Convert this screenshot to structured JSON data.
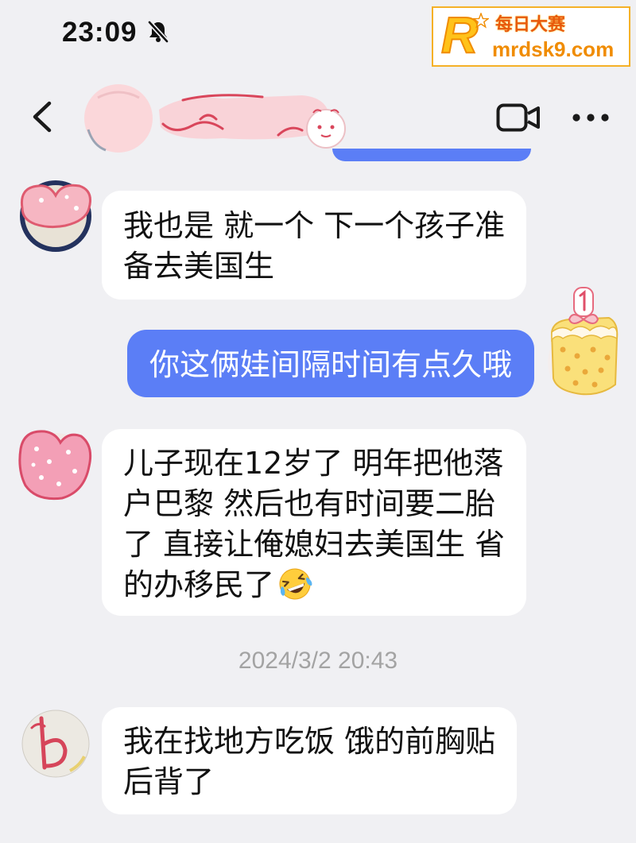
{
  "status_bar": {
    "time": "23:09",
    "mute_icon": "bell-slash-icon"
  },
  "watermark": {
    "logo_letter": "R",
    "brand_text": "每日大赛",
    "site_text": "mrdsk9.com"
  },
  "header": {
    "back_icon": "chevron-left-icon",
    "video_call_icon": "video-camera-icon",
    "more_icon": "more-dots-icon"
  },
  "chat": {
    "messages": [
      {
        "lines": [
          "我也是 就一个 下一个孩子准",
          "备去美国生"
        ]
      },
      {
        "lines": [
          "你这俩娃间隔时间有点久哦"
        ]
      },
      {
        "lines": [
          "儿子现在12岁了 明年把他落",
          "户巴黎 然后也有时间要二胎",
          "了 直接让俺媳妇去美国生 省",
          "的办移民了"
        ],
        "emoji": "rofl-emoji-icon"
      },
      {
        "lines": [
          "我在找地方吃饭 饿的前胸贴",
          "后背了"
        ]
      }
    ],
    "timestamp": "2024/3/2 20:43"
  },
  "colors": {
    "page_bg": "#f0f0f3",
    "bubble_incoming": "#ffffff",
    "bubble_outgoing": "#5b7ef6",
    "text_primary": "#111111",
    "timestamp_text": "#a3a3a3",
    "watermark_accent": "#f08c00"
  }
}
